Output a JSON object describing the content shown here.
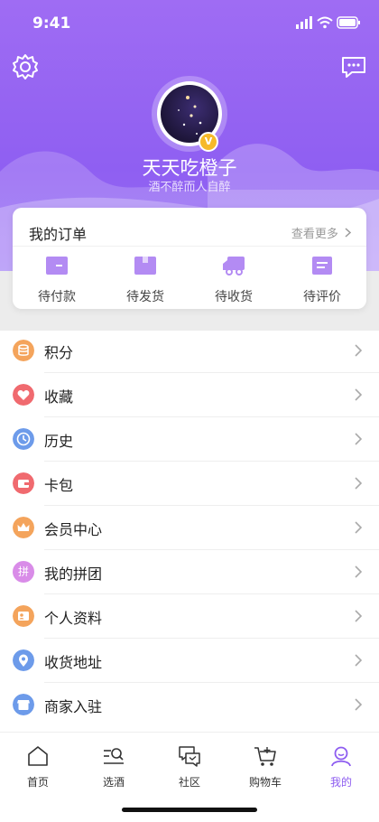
{
  "status": {
    "time": "9:41"
  },
  "profile": {
    "name": "天天吃橙子",
    "motto": "酒不醉而人自醉",
    "badge": "V"
  },
  "orders": {
    "title": "我的订单",
    "more": "查看更多",
    "items": [
      {
        "label": "待付款",
        "icon": "wallet-icon"
      },
      {
        "label": "待发货",
        "icon": "box-icon"
      },
      {
        "label": "待收货",
        "icon": "truck-icon"
      },
      {
        "label": "待评价",
        "icon": "comment-icon"
      }
    ]
  },
  "menu": [
    {
      "label": "积分",
      "icon": "points-icon",
      "color": "#f4a45c"
    },
    {
      "label": "收藏",
      "icon": "heart-icon",
      "color": "#f06a6f"
    },
    {
      "label": "历史",
      "icon": "clock-icon",
      "color": "#6d9bea"
    },
    {
      "label": "卡包",
      "icon": "card-wallet-icon",
      "color": "#f06a6f"
    },
    {
      "label": "会员中心",
      "icon": "crown-icon",
      "color": "#f4a45c"
    },
    {
      "label": "我的拼团",
      "icon": "group-buy-icon",
      "color": "#d98ce8",
      "glyph": "拼"
    },
    {
      "label": "个人资料",
      "icon": "profile-card-icon",
      "color": "#f4a45c"
    },
    {
      "label": "收货地址",
      "icon": "location-icon",
      "color": "#6d9bea"
    },
    {
      "label": "商家入驻",
      "icon": "shop-icon",
      "color": "#6d9bea"
    }
  ],
  "tabs": [
    {
      "label": "首页",
      "icon": "home-icon"
    },
    {
      "label": "选酒",
      "icon": "search-list-icon"
    },
    {
      "label": "社区",
      "icon": "chat-icon"
    },
    {
      "label": "购物车",
      "icon": "cart-icon"
    },
    {
      "label": "我的",
      "icon": "user-icon",
      "active": true
    }
  ],
  "colors": {
    "accent": "#8d5cf0",
    "header": "#9f6cf3"
  }
}
